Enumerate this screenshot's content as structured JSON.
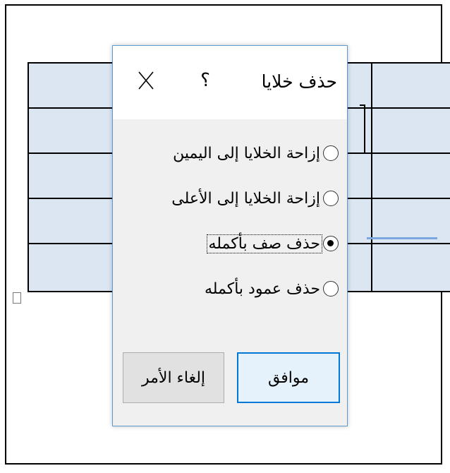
{
  "dialog": {
    "title": "حذف خلايا",
    "help_label": "؟",
    "options": [
      {
        "label": "إزاحة الخلايا إلى اليمين",
        "selected": false
      },
      {
        "label": "إزاحة الخلايا إلى الأعلى",
        "selected": false
      },
      {
        "label": "حذف صف بأكمله",
        "selected": true
      },
      {
        "label": "حذف عمود بأكمله",
        "selected": false
      }
    ],
    "ok_label": "موافق",
    "cancel_label": "إلغاء الأمر"
  },
  "colors": {
    "table_fill": "#dce6f2",
    "dialog_border": "#5b9bd5",
    "ok_border": "#0078d7",
    "ok_fill": "#e5f1fb"
  }
}
